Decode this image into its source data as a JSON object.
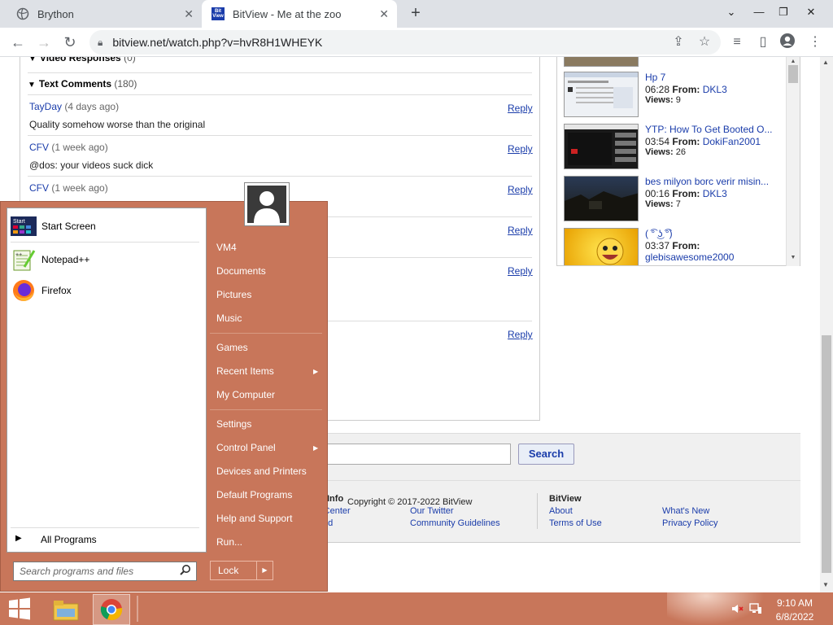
{
  "browser": {
    "tabs": [
      {
        "title": "Brython"
      },
      {
        "title": "BitView - Me at the zoo",
        "favicon_text_1": "Bit",
        "favicon_text_2": "View"
      }
    ],
    "url": "bitview.net/watch.php?v=hvR8H1WHEYK"
  },
  "comments": {
    "video_responses_label": "Video Responses",
    "video_responses_count": "(0)",
    "text_comments_label": "Text Comments",
    "text_comments_count": "(180)",
    "reply_label": "Reply",
    "items": [
      {
        "user": "TayDay",
        "ago": "(4 days ago)",
        "text": "Quality somehow worse than the original"
      },
      {
        "user": "CFV",
        "ago": "(1 week ago)",
        "text": "@dos: your videos suck dick"
      },
      {
        "user": "CFV",
        "ago": "(1 week ago)",
        "text": ""
      }
    ]
  },
  "related": [
    {
      "title": "Hp 7",
      "duration": "06:28",
      "from_label": "From:",
      "author": "DKL3",
      "views_label": "Views:",
      "views": "9"
    },
    {
      "title": "YTP: How To Get Booted O...",
      "duration": "03:54",
      "from_label": "From:",
      "author": "DokiFan2001",
      "views_label": "Views:",
      "views": "26"
    },
    {
      "title": "bes milyon borc verir misin...",
      "duration": "00:16",
      "from_label": "From:",
      "author": "DKL3",
      "views_label": "Views:",
      "views": "7"
    },
    {
      "title": "( ͡° ͜ʖ ͡°)",
      "duration": "03:37",
      "from_label": "From:",
      "author": "glebisawesome2000",
      "views_label": "",
      "views": ""
    }
  ],
  "footer": {
    "search_button": "Search",
    "info_heading": "Info",
    "info_links": [
      "Help Center",
      "Discord"
    ],
    "col2_links": [
      "Our Twitter",
      "Community Guidelines"
    ],
    "bitview_heading": "BitView",
    "bitview_links": [
      "About",
      "Terms of Use"
    ],
    "col4_links": [
      "What's New",
      "Privacy Policy"
    ],
    "copyright": "Copyright © 2017-2022 BitView"
  },
  "start_menu": {
    "pinned": [
      {
        "label": "Start Screen",
        "icon_text": "Start"
      },
      {
        "label": "Notepad++"
      },
      {
        "label": "Firefox"
      }
    ],
    "all_programs": "All Programs",
    "search_placeholder": "Search programs and files",
    "right_items": [
      "VM4",
      "Documents",
      "Pictures",
      "Music",
      "Games",
      "Recent Items",
      "My Computer",
      "Settings",
      "Control Panel",
      "Devices and Printers",
      "Default Programs",
      "Help and Support",
      "Run..."
    ],
    "lock_label": "Lock"
  },
  "taskbar": {
    "time": "9:10 AM",
    "date": "6/8/2022"
  },
  "colors": {
    "accent": "#c8765a",
    "link": "#1a3caa"
  }
}
